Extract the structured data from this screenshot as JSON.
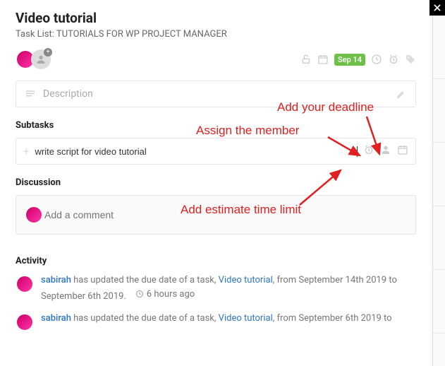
{
  "header": {
    "title": "Video tutorial",
    "tasklist_prefix": "Task List: ",
    "tasklist_name": "TUTORIALS FOR WP PROJECT MANAGER",
    "date_badge": "Sep 14"
  },
  "description": {
    "placeholder": "Description"
  },
  "subtasks": {
    "heading": "Subtasks",
    "input_value": "write script for video tutorial"
  },
  "discussion": {
    "heading": "Discussion",
    "comment_placeholder": "Add a comment"
  },
  "activity": {
    "heading": "Activity",
    "items": [
      {
        "user": "sabirah",
        "verb": " has updated the due date of a task, ",
        "task": "Video tutorial",
        "tail": ", from September 14th 2019 to September 6th 2019.",
        "time": "6 hours ago"
      },
      {
        "user": "sabirah",
        "verb": " has updated the due date of a task, ",
        "task": "Video tutorial",
        "tail": ", from September 6th 2019 to"
      }
    ]
  },
  "annotations": {
    "deadline": "Add your deadline",
    "assign": "Assign the member",
    "estimate": "Add estimate time limit"
  }
}
